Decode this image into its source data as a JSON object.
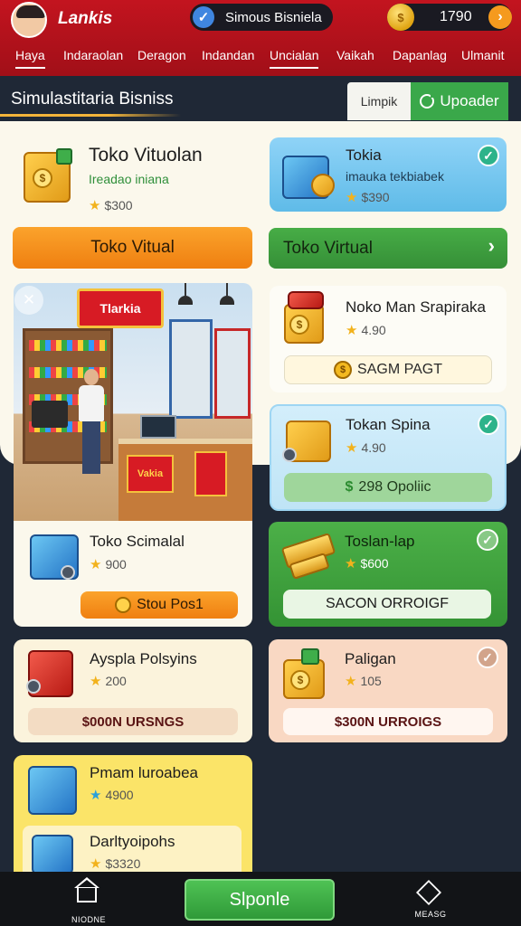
{
  "header": {
    "app_name": "Lankis",
    "status_text": "Simous Bisniela",
    "coins": "1790",
    "tabs": [
      "Haya",
      "Indaraolan",
      "Deragon",
      "Indandan",
      "Uncialan",
      "Vaikah",
      "Dapanlag",
      "Ulmanit"
    ]
  },
  "section": {
    "title": "Simulastitaria Bisniss",
    "toggle_light": "Limpik",
    "toggle_green": "Upoader"
  },
  "featured": {
    "title": "Toko Vituolan",
    "subtitle": "Ireadao iniana",
    "price": "$300",
    "button": "Toko Vitual"
  },
  "promo": {
    "title": "Tokia",
    "subtitle": "imauka tekbiabek",
    "price": "$390",
    "button": "Toko Virtual"
  },
  "shop_card": {
    "sign_text": "Tlarkia",
    "banner_text": "Vakia",
    "title": "Toko Scimalal",
    "price": "900",
    "button": "Stou Pos1"
  },
  "cards": [
    {
      "title": "Noko Man Srapiraka",
      "rating": "4.90",
      "button": "SAGM PAGT",
      "coin_label": "$"
    },
    {
      "title": "Tokan Spina",
      "rating": "4.90",
      "button": "298 Opoliic",
      "button_icon": "$"
    },
    {
      "title": "Toslan-lap",
      "rating": "$600",
      "button": "SACON ORROIGF"
    },
    {
      "title": "Ayspla Polsyins",
      "rating": "200",
      "button": "$000N URSNGS"
    },
    {
      "title": "Paligan",
      "rating": "105",
      "button": "$300N URROIGS"
    },
    {
      "title": "Pmam luroabea",
      "rating": "4900"
    },
    {
      "title": "Darltyoipohs",
      "rating": "$3320"
    }
  ],
  "bottom_nav": {
    "home_label": "NIODNE",
    "center_button": "Slponle",
    "right_label": "MEASG"
  },
  "colors": {
    "header_red": "#c3141f",
    "accent_orange": "#ef7f10",
    "accent_green": "#3aa84a",
    "check_teal": "#2db38a"
  }
}
